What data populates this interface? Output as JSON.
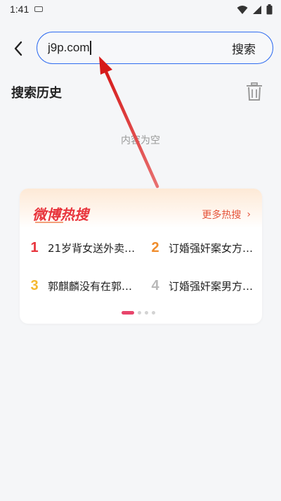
{
  "status_bar": {
    "time": "1:41"
  },
  "search": {
    "value": "j9p.com",
    "button_label": "搜索"
  },
  "history": {
    "title": "搜索历史",
    "empty_text": "内容为空"
  },
  "hot_card": {
    "logo_text": "微博热搜",
    "more_label": "更多热搜",
    "more_arrow": "›",
    "items": [
      {
        "rank": "1",
        "title": "21岁背女送外卖的…",
        "rank_color": "#e8343c"
      },
      {
        "rank": "2",
        "title": "订婚强奸案女方未…",
        "rank_color": "#f08c2b"
      },
      {
        "rank": "3",
        "title": "郭麒麟没有在郭德…",
        "rank_color": "#f5b82e"
      },
      {
        "rank": "4",
        "title": "订婚强奸案男方曾…",
        "rank_color": "#b8b8b8"
      }
    ],
    "page_index": 1,
    "page_count": 4
  },
  "colors": {
    "accent": "#2f6cf0",
    "hot_orange": "#e5533a",
    "annotation_arrow": "#e02020"
  }
}
